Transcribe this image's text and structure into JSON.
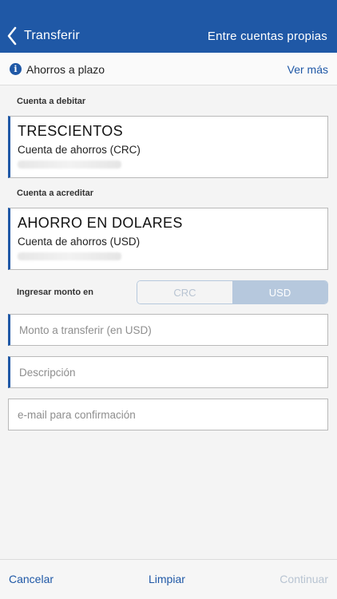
{
  "header": {
    "back_label": "Transferir",
    "title": "Entre cuentas propias",
    "bg_color": "#1f58a6"
  },
  "info_bar": {
    "icon": "info-icon",
    "title": "Ahorros a plazo",
    "link": "Ver más"
  },
  "debit": {
    "section_label": "Cuenta a debitar",
    "account_name": "TRESCIENTOS",
    "account_type": "Cuenta de ahorros (CRC)"
  },
  "credit": {
    "section_label": "Cuenta a acreditar",
    "account_name": "AHORRO EN DOLARES",
    "account_type": "Cuenta de ahorros (USD)"
  },
  "currency": {
    "label": "Ingresar monto en",
    "options": [
      "CRC",
      "USD"
    ],
    "selected": "USD"
  },
  "fields": {
    "amount_placeholder": "Monto a transferir (en USD)",
    "description_placeholder": "Descripción",
    "email_placeholder": "e-mail para confirmación"
  },
  "footer": {
    "cancel": "Cancelar",
    "clear": "Limpiar",
    "continue": "Continuar"
  }
}
